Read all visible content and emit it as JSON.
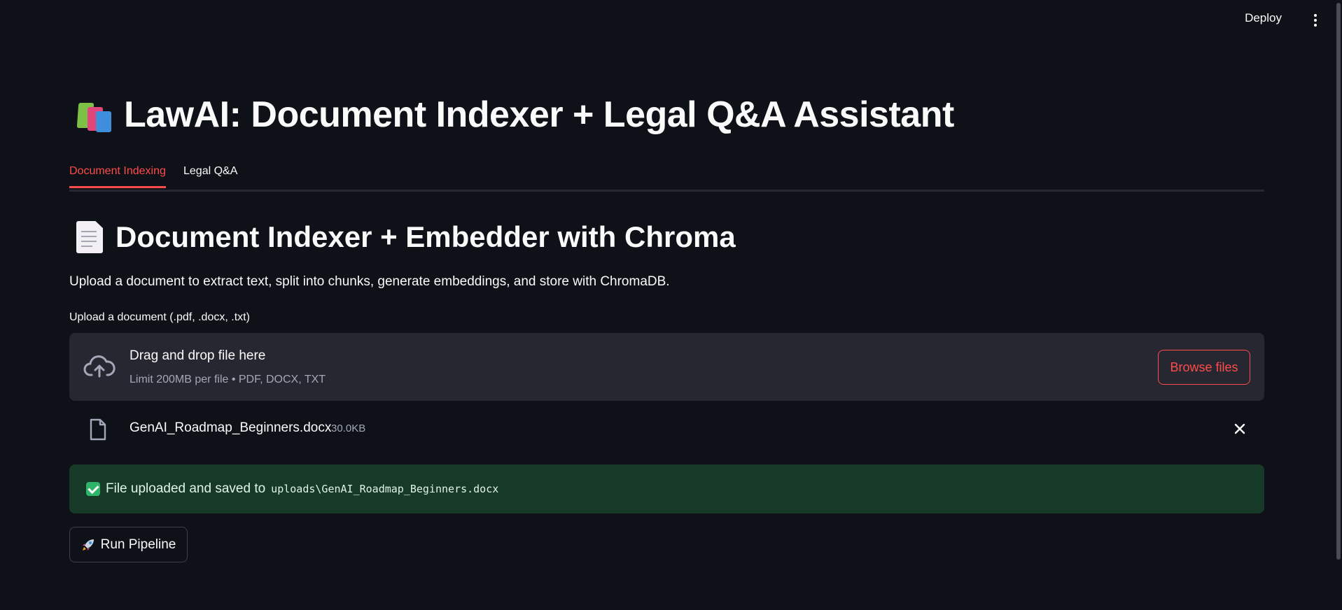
{
  "header": {
    "deploy_label": "Deploy"
  },
  "app": {
    "title": "LawAI: Document Indexer + Legal Q&A Assistant",
    "title_icon": "books-icon"
  },
  "tabs": [
    {
      "label": "Document Indexing",
      "active": true
    },
    {
      "label": "Legal Q&A",
      "active": false
    }
  ],
  "section": {
    "title": "Document Indexer + Embedder with Chroma",
    "title_icon": "document-icon",
    "description": "Upload a document to extract text, split into chunks, generate embeddings, and store with ChromaDB."
  },
  "uploader": {
    "label": "Upload a document (.pdf, .docx, .txt)",
    "drop_title": "Drag and drop file here",
    "drop_subtitle": "Limit 200MB per file • PDF, DOCX, TXT",
    "browse_label": "Browse files"
  },
  "uploaded_file": {
    "name": "GenAI_Roadmap_Beginners.docx",
    "size": "30.0KB"
  },
  "status": {
    "message": "File uploaded and saved to",
    "path": "uploads\\GenAI_Roadmap_Beginners.docx"
  },
  "actions": {
    "run_label": "Run Pipeline"
  },
  "colors": {
    "background": "#0e1117",
    "accent": "#ff4b4b",
    "surface": "#262730",
    "success_bg": "#173928"
  }
}
